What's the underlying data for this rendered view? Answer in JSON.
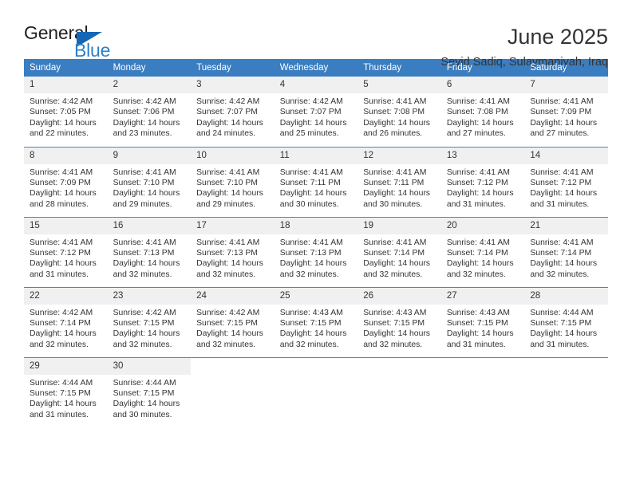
{
  "logo": {
    "word_top": "General",
    "word_bottom": "Blue",
    "triangle_color": "#1567b5",
    "blue_color": "#2b7fc9"
  },
  "header": {
    "title": "June 2025",
    "subtitle": "Seyid Sadiq, Sulaymaniyah, Iraq"
  },
  "theme": {
    "header_bg": "#3a7dc0",
    "daynum_bg": "#f0f0f0",
    "row_rule": "#4a86c5"
  },
  "weekdays": [
    "Sunday",
    "Monday",
    "Tuesday",
    "Wednesday",
    "Thursday",
    "Friday",
    "Saturday"
  ],
  "weeks": [
    [
      {
        "day": "1",
        "sunrise": "Sunrise: 4:42 AM",
        "sunset": "Sunset: 7:05 PM",
        "daylight": "Daylight: 14 hours and 22 minutes."
      },
      {
        "day": "2",
        "sunrise": "Sunrise: 4:42 AM",
        "sunset": "Sunset: 7:06 PM",
        "daylight": "Daylight: 14 hours and 23 minutes."
      },
      {
        "day": "3",
        "sunrise": "Sunrise: 4:42 AM",
        "sunset": "Sunset: 7:07 PM",
        "daylight": "Daylight: 14 hours and 24 minutes."
      },
      {
        "day": "4",
        "sunrise": "Sunrise: 4:42 AM",
        "sunset": "Sunset: 7:07 PM",
        "daylight": "Daylight: 14 hours and 25 minutes."
      },
      {
        "day": "5",
        "sunrise": "Sunrise: 4:41 AM",
        "sunset": "Sunset: 7:08 PM",
        "daylight": "Daylight: 14 hours and 26 minutes."
      },
      {
        "day": "6",
        "sunrise": "Sunrise: 4:41 AM",
        "sunset": "Sunset: 7:08 PM",
        "daylight": "Daylight: 14 hours and 27 minutes."
      },
      {
        "day": "7",
        "sunrise": "Sunrise: 4:41 AM",
        "sunset": "Sunset: 7:09 PM",
        "daylight": "Daylight: 14 hours and 27 minutes."
      }
    ],
    [
      {
        "day": "8",
        "sunrise": "Sunrise: 4:41 AM",
        "sunset": "Sunset: 7:09 PM",
        "daylight": "Daylight: 14 hours and 28 minutes."
      },
      {
        "day": "9",
        "sunrise": "Sunrise: 4:41 AM",
        "sunset": "Sunset: 7:10 PM",
        "daylight": "Daylight: 14 hours and 29 minutes."
      },
      {
        "day": "10",
        "sunrise": "Sunrise: 4:41 AM",
        "sunset": "Sunset: 7:10 PM",
        "daylight": "Daylight: 14 hours and 29 minutes."
      },
      {
        "day": "11",
        "sunrise": "Sunrise: 4:41 AM",
        "sunset": "Sunset: 7:11 PM",
        "daylight": "Daylight: 14 hours and 30 minutes."
      },
      {
        "day": "12",
        "sunrise": "Sunrise: 4:41 AM",
        "sunset": "Sunset: 7:11 PM",
        "daylight": "Daylight: 14 hours and 30 minutes."
      },
      {
        "day": "13",
        "sunrise": "Sunrise: 4:41 AM",
        "sunset": "Sunset: 7:12 PM",
        "daylight": "Daylight: 14 hours and 31 minutes."
      },
      {
        "day": "14",
        "sunrise": "Sunrise: 4:41 AM",
        "sunset": "Sunset: 7:12 PM",
        "daylight": "Daylight: 14 hours and 31 minutes."
      }
    ],
    [
      {
        "day": "15",
        "sunrise": "Sunrise: 4:41 AM",
        "sunset": "Sunset: 7:12 PM",
        "daylight": "Daylight: 14 hours and 31 minutes."
      },
      {
        "day": "16",
        "sunrise": "Sunrise: 4:41 AM",
        "sunset": "Sunset: 7:13 PM",
        "daylight": "Daylight: 14 hours and 32 minutes."
      },
      {
        "day": "17",
        "sunrise": "Sunrise: 4:41 AM",
        "sunset": "Sunset: 7:13 PM",
        "daylight": "Daylight: 14 hours and 32 minutes."
      },
      {
        "day": "18",
        "sunrise": "Sunrise: 4:41 AM",
        "sunset": "Sunset: 7:13 PM",
        "daylight": "Daylight: 14 hours and 32 minutes."
      },
      {
        "day": "19",
        "sunrise": "Sunrise: 4:41 AM",
        "sunset": "Sunset: 7:14 PM",
        "daylight": "Daylight: 14 hours and 32 minutes."
      },
      {
        "day": "20",
        "sunrise": "Sunrise: 4:41 AM",
        "sunset": "Sunset: 7:14 PM",
        "daylight": "Daylight: 14 hours and 32 minutes."
      },
      {
        "day": "21",
        "sunrise": "Sunrise: 4:41 AM",
        "sunset": "Sunset: 7:14 PM",
        "daylight": "Daylight: 14 hours and 32 minutes."
      }
    ],
    [
      {
        "day": "22",
        "sunrise": "Sunrise: 4:42 AM",
        "sunset": "Sunset: 7:14 PM",
        "daylight": "Daylight: 14 hours and 32 minutes."
      },
      {
        "day": "23",
        "sunrise": "Sunrise: 4:42 AM",
        "sunset": "Sunset: 7:15 PM",
        "daylight": "Daylight: 14 hours and 32 minutes."
      },
      {
        "day": "24",
        "sunrise": "Sunrise: 4:42 AM",
        "sunset": "Sunset: 7:15 PM",
        "daylight": "Daylight: 14 hours and 32 minutes."
      },
      {
        "day": "25",
        "sunrise": "Sunrise: 4:43 AM",
        "sunset": "Sunset: 7:15 PM",
        "daylight": "Daylight: 14 hours and 32 minutes."
      },
      {
        "day": "26",
        "sunrise": "Sunrise: 4:43 AM",
        "sunset": "Sunset: 7:15 PM",
        "daylight": "Daylight: 14 hours and 32 minutes."
      },
      {
        "day": "27",
        "sunrise": "Sunrise: 4:43 AM",
        "sunset": "Sunset: 7:15 PM",
        "daylight": "Daylight: 14 hours and 31 minutes."
      },
      {
        "day": "28",
        "sunrise": "Sunrise: 4:44 AM",
        "sunset": "Sunset: 7:15 PM",
        "daylight": "Daylight: 14 hours and 31 minutes."
      }
    ],
    [
      {
        "day": "29",
        "sunrise": "Sunrise: 4:44 AM",
        "sunset": "Sunset: 7:15 PM",
        "daylight": "Daylight: 14 hours and 31 minutes."
      },
      {
        "day": "30",
        "sunrise": "Sunrise: 4:44 AM",
        "sunset": "Sunset: 7:15 PM",
        "daylight": "Daylight: 14 hours and 30 minutes."
      },
      {
        "day": "",
        "sunrise": "",
        "sunset": "",
        "daylight": ""
      },
      {
        "day": "",
        "sunrise": "",
        "sunset": "",
        "daylight": ""
      },
      {
        "day": "",
        "sunrise": "",
        "sunset": "",
        "daylight": ""
      },
      {
        "day": "",
        "sunrise": "",
        "sunset": "",
        "daylight": ""
      },
      {
        "day": "",
        "sunrise": "",
        "sunset": "",
        "daylight": ""
      }
    ]
  ]
}
